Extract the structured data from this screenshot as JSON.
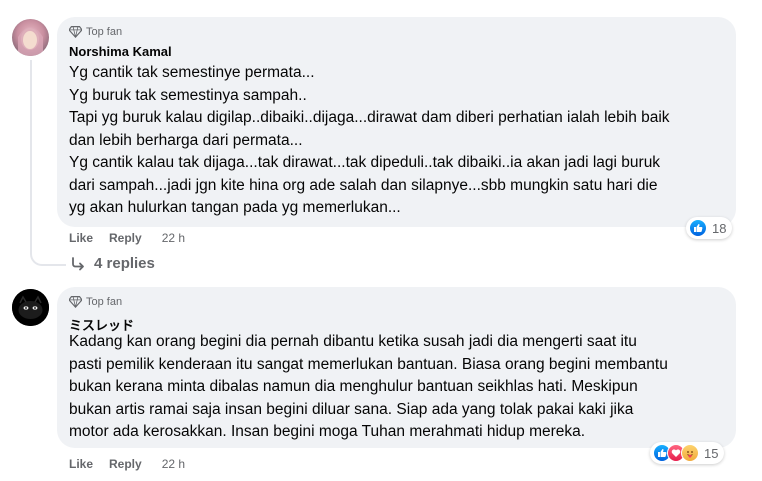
{
  "comments": [
    {
      "badge": "Top fan",
      "author": "Norshima Kamal",
      "lines": [
        "Yg cantik tak semestinye permata...",
        "Yg buruk tak semestinya sampah..",
        "Tapi yg buruk kalau digilap..dibaiki..dijaga...dirawat dam diberi perhatian ialah lebih baik",
        "dan lebih berharga dari permata...",
        "Yg cantik kalau tak dijaga...tak dirawat...tak dipeduli..tak dibaiki..ia akan jadi lagi buruk",
        "dari sampah...jadi jgn kite hina org ade salah dan silapnye...sbb mungkin satu hari die",
        "yg akan hulurkan tangan pada yg memerlukan..."
      ],
      "like_label": "Like",
      "reply_label": "Reply",
      "time": "22 h",
      "reaction_count": "18",
      "reaction_icons": [
        "like-icon"
      ],
      "replies_label": "4 replies"
    },
    {
      "badge": "Top fan",
      "author": "ミスレッド",
      "lines": [
        "Kadang kan orang begini dia pernah dibantu ketika susah jadi dia mengerti saat itu",
        "pasti pemilik kenderaan itu sangat memerlukan bantuan. Biasa orang begini membantu",
        "bukan kerana minta dibalas namun dia menghulur bantuan seikhlas hati. Meskipun",
        "bukan artis ramai saja insan begini diluar sana. Siap ada yang tolak pakai kaki jika",
        "motor ada kerosakkan. Insan begini moga Tuhan merahmati hidup mereka."
      ],
      "like_label": "Like",
      "reply_label": "Reply",
      "time": "22 h",
      "reaction_count": "15",
      "reaction_icons": [
        "like-icon",
        "love-icon",
        "care-icon"
      ]
    }
  ],
  "colors": {
    "bubble": "#f0f2f5",
    "secondary_text": "#65676b",
    "like_blue": "#0866ff",
    "love_red": "#f33e58",
    "care_yellow": "#f7b125"
  }
}
